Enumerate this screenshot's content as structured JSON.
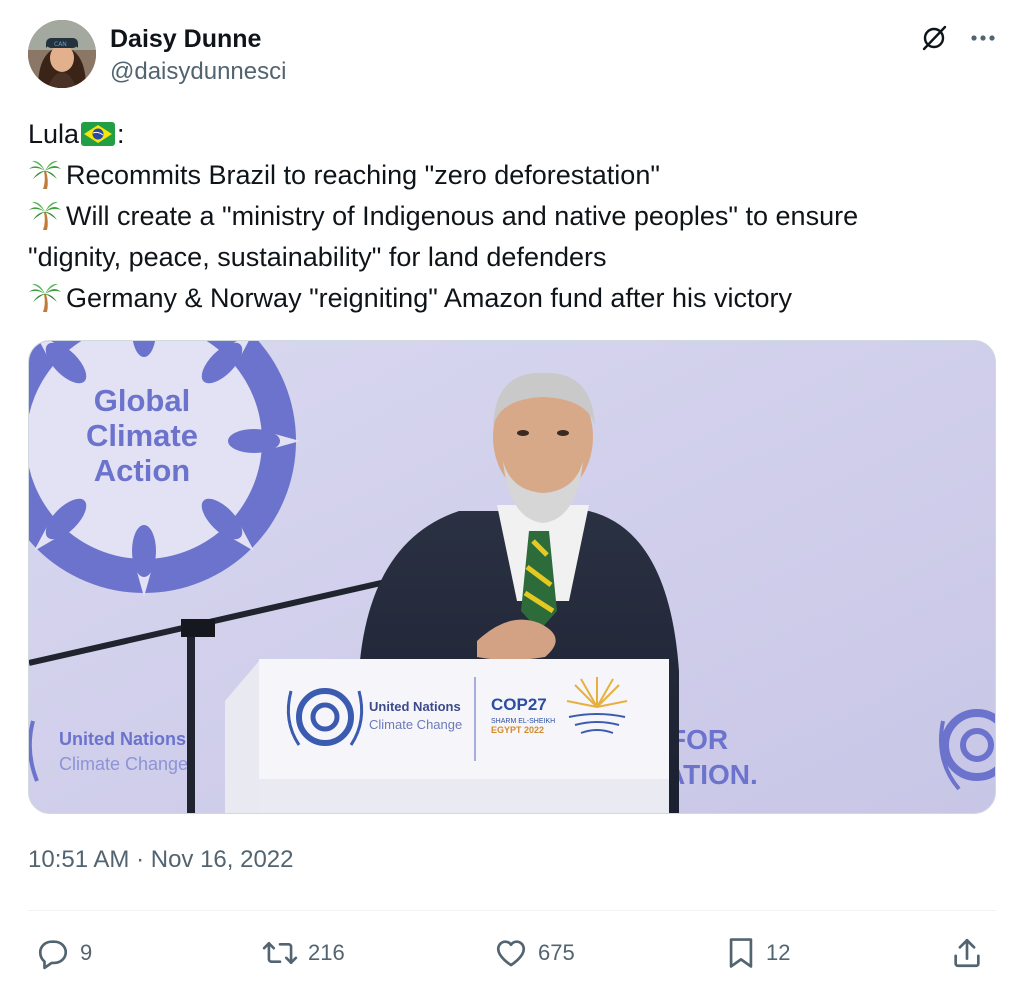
{
  "author": {
    "display_name": "Daisy Dunne",
    "handle": "@daisydunnesci"
  },
  "tweet": {
    "lines": [
      "Lula",
      ":",
      "Recommits Brazil to reaching \"zero deforestation\"",
      "Will create a \"ministry of Indigenous and native peoples\" to ensure",
      "\"dignity, peace, sustainability\" for land defenders",
      "Germany & Norway \"reigniting\" Amazon fund after his victory"
    ],
    "emoji": [
      "brazil-flag",
      "palm-tree"
    ]
  },
  "media": {
    "banner_line1": "Global",
    "banner_line2": "Climate",
    "banner_line3": "Action",
    "un_left_line1": "United Nations",
    "un_left_line2": "Climate Change",
    "podium_un_line1": "United Nations",
    "podium_un_line2": "Climate Change",
    "cop_title": "COP27",
    "cop_sub1": "SHARM EL-SHEIKH",
    "cop_sub2": "EGYPT 2022",
    "right_line1": "FOR",
    "right_line2": "ATION."
  },
  "timestamp": "10:51 AM · Nov 16, 2022",
  "stats": {
    "replies": "9",
    "retweets": "216",
    "likes": "675",
    "bookmarks": "12"
  },
  "colors": {
    "text": "#0f1419",
    "secondary": "#536471",
    "banner_blue": "#6b73cc",
    "backdrop": "#cfcde8"
  }
}
